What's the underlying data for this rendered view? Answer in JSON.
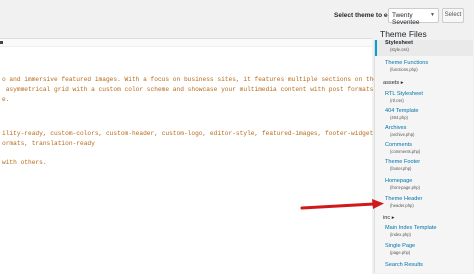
{
  "header": {
    "select_label": "Select theme to edit:",
    "theme_value": "Twenty Seventee",
    "select_button": "Select"
  },
  "editor": {
    "lines": [
      "o and immersive featured images. With a focus on business sites, it features multiple sections on the front page as well as",
      " asymmetrical grid with a custom color scheme and showcase your multimedia content with post formats. Our default theme for",
      "e.",
      "",
      "",
      "",
      "",
      "ility-ready, custom-colors, custom-header, custom-logo, editor-style, featured-images, footer-widgets, post-",
      "ormats, translation-ready",
      "",
      "",
      "with others."
    ]
  },
  "sidebar": {
    "title": "Theme Files",
    "files": [
      {
        "name": "Stylesheet",
        "sub": "(style.css)"
      },
      {
        "name": "Theme Functions",
        "sub": "(functions.php)"
      },
      {
        "folder": "assets ▸"
      },
      {
        "name": "RTL Stylesheet",
        "sub": "(rtl.css)"
      },
      {
        "name": "404 Template",
        "sub": "(404.php)"
      },
      {
        "name": "Archives",
        "sub": "(archive.php)"
      },
      {
        "name": "Comments",
        "sub": "(comments.php)"
      },
      {
        "name": "Theme Footer",
        "sub": "(footer.php)"
      },
      {
        "name": "Homepage",
        "sub": "(front-page.php)"
      },
      {
        "name": "Theme Header",
        "sub": "(header.php)"
      },
      {
        "folder": "inc ▸"
      },
      {
        "name": "Main Index Template",
        "sub": "(index.php)"
      },
      {
        "name": "Single Page",
        "sub": "(page.php)"
      },
      {
        "name": "Search Results",
        "sub": ""
      }
    ]
  },
  "colors": {
    "code": "#b8691a",
    "link": "#0073aa",
    "accent": "#00a0d2",
    "arrow": "#d0191b"
  }
}
